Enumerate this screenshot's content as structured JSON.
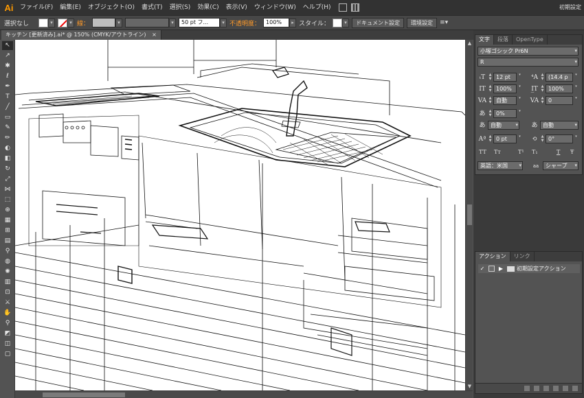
{
  "app": {
    "logo": "Ai",
    "workspace": "初期設定"
  },
  "menu": {
    "items": [
      "ファイル(F)",
      "編集(E)",
      "オブジェクト(O)",
      "書式(T)",
      "選択(S)",
      "効果(C)",
      "表示(V)",
      "ウィンドウ(W)",
      "ヘルプ(H)"
    ]
  },
  "control": {
    "selection": "選択なし",
    "stroke_label": "線：",
    "brush_value": "50 pt フ...",
    "opacity_label": "不透明度：",
    "opacity_value": "100%",
    "style_label": "スタイル：",
    "document_setup": "ドキュメント設定",
    "preferences": "環境設定"
  },
  "document": {
    "tab_title": "キッチン [更新済み].ai* @ 150% (CMYK/アウトライン)",
    "close_glyph": "×"
  },
  "character_panel": {
    "tabs": [
      "文字",
      "段落",
      "OpenType"
    ],
    "font_family": "小塚ゴシック Pr6N",
    "font_style": "R",
    "font_size": "12 pt",
    "leading": "(14.4 p",
    "vertical_scale": "100%",
    "horizontal_scale": "100%",
    "kerning": "自動",
    "tracking": "0",
    "tsume": "0%",
    "aki_left": "自動",
    "aki_right": "自動",
    "baseline_shift": "0 pt",
    "rotation": "0°",
    "glyphs": [
      "TT",
      "Tт",
      "T¹",
      "T₁",
      "T",
      "Ŧ"
    ],
    "language": "英語：米国",
    "aa_icon_label": "aa",
    "antialias": "シャープ"
  },
  "actions_panel": {
    "tabs": [
      "アクション",
      "リンク"
    ],
    "set_name": "初期設定アクション",
    "check_glyph": "✓",
    "expand_glyph": "▶"
  },
  "colors": {
    "accent": "#ff9a00",
    "canvas": "#ffffff",
    "panel": "#535353"
  }
}
